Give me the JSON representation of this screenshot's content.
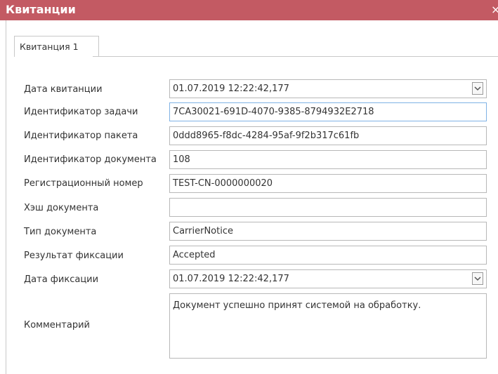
{
  "window": {
    "title": "Квитанции",
    "close_glyph": "×"
  },
  "tabs": [
    {
      "label": "Квитанция 1"
    }
  ],
  "form": {
    "labels": {
      "receipt_date": "Дата квитанции",
      "task_id": "Идентификатор задачи",
      "package_id": "Идентификатор пакета",
      "document_id": "Идентификатор документа",
      "registration_number": "Регистрационный номер",
      "document_hash": "Хэш документа",
      "document_type": "Тип документа",
      "fixation_result": "Результат фиксации",
      "fixation_date": "Дата фиксации",
      "comment": "Комментарий"
    },
    "values": {
      "receipt_date": "01.07.2019 12:22:42,177",
      "task_id": "7CA30021-691D-4070-9385-8794932E2718",
      "package_id": "0ddd8965-f8dc-4284-95af-9f2b317c61fb",
      "document_id": "108",
      "registration_number": "TEST-CN-0000000020",
      "document_hash": "",
      "document_type": "CarrierNotice",
      "fixation_result": "Accepted",
      "fixation_date": "01.07.2019 12:22:42,177",
      "comment": "Документ успешно принят системой на обработку."
    }
  },
  "icons": {
    "dropdown": "chevron-down-icon",
    "close": "close-icon"
  },
  "colors": {
    "titlebar": "#c35a63",
    "focus_border": "#7fb2e5"
  }
}
